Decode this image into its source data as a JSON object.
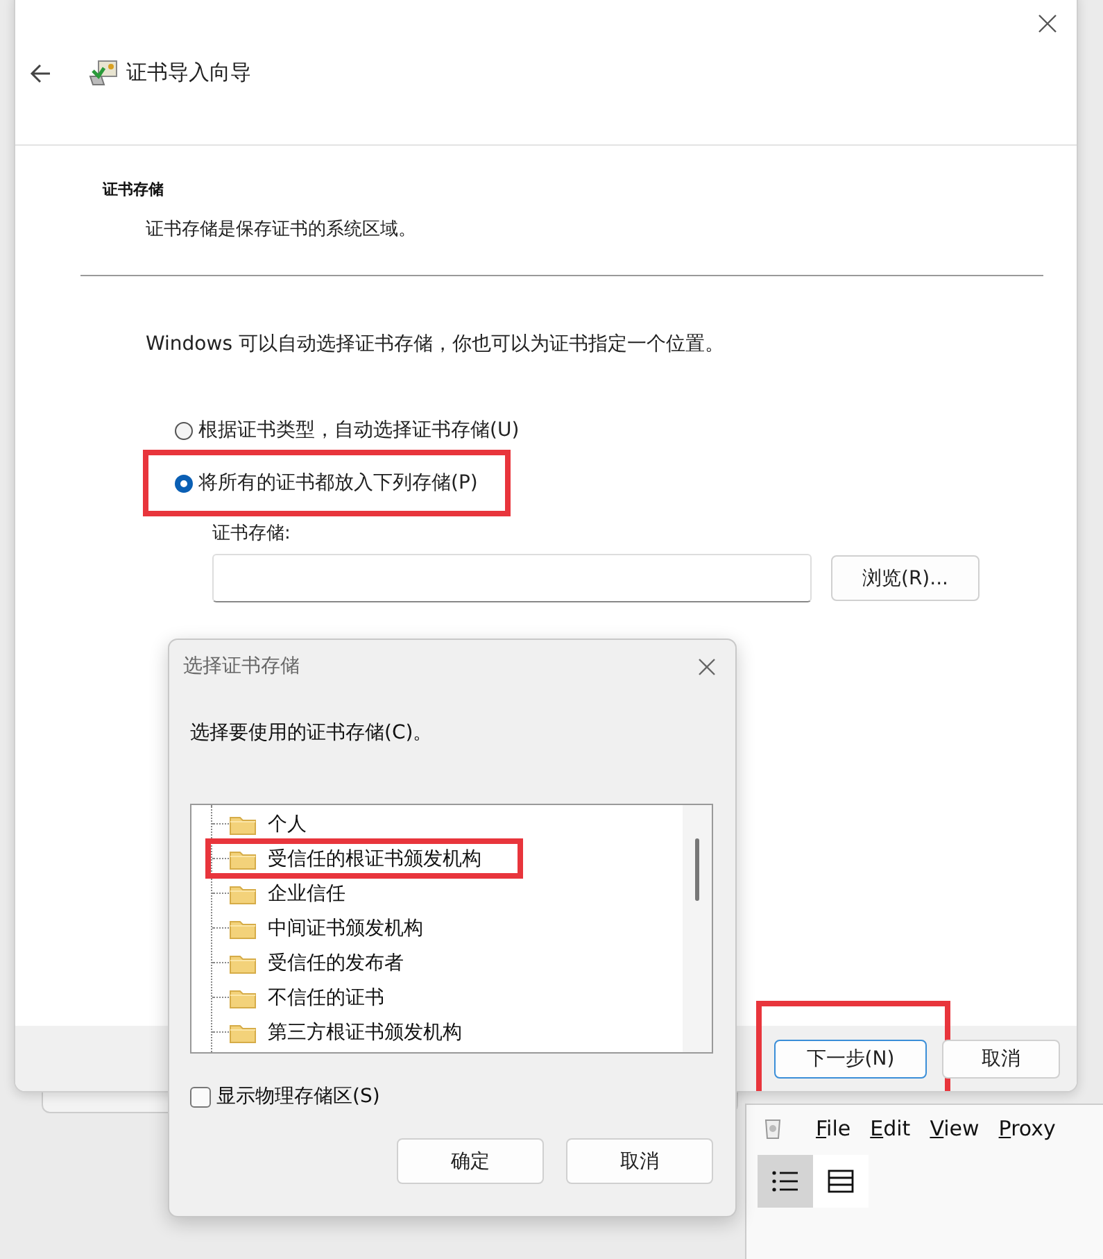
{
  "wizard": {
    "title": "证书导入向导",
    "section_title": "证书存储",
    "section_subtitle": "证书存储是保存证书的系统区域。",
    "intro": "Windows 可以自动选择证书存储，你也可以为证书指定一个位置。",
    "options": [
      {
        "label": "根据证书类型，自动选择证书存储(U)",
        "selected": false,
        "highlighted": false
      },
      {
        "label": "将所有的证书都放入下列存储(P)",
        "selected": true,
        "highlighted": true
      }
    ],
    "store_label": "证书存储:",
    "browse_button": "浏览(R)...",
    "buttons": [
      {
        "label": "下一步(N)",
        "default": true,
        "highlighted": true
      },
      {
        "label": "取消",
        "default": false,
        "highlighted": false
      }
    ]
  },
  "dialog": {
    "title": "选择证书存储",
    "prompt": "选择要使用的证书存储(C)。",
    "stores": [
      {
        "label": "个人",
        "highlighted": false
      },
      {
        "label": "受信任的根证书颁发机构",
        "highlighted": true
      },
      {
        "label": "企业信任",
        "highlighted": false
      },
      {
        "label": "中间证书颁发机构",
        "highlighted": false
      },
      {
        "label": "受信任的发布者",
        "highlighted": false
      },
      {
        "label": "不信任的证书",
        "highlighted": false
      },
      {
        "label": "第三方根证书颁发机构",
        "highlighted": false
      }
    ],
    "show_physical": {
      "label": "显示物理存储区(S)",
      "checked": false
    },
    "buttons": [
      "确定",
      "取消"
    ]
  },
  "background_window": {
    "menu": [
      "File",
      "Edit",
      "View",
      "Proxy"
    ],
    "toolbar": [
      {
        "kind": "list",
        "selected": true
      },
      {
        "kind": "rows",
        "selected": false
      }
    ]
  }
}
